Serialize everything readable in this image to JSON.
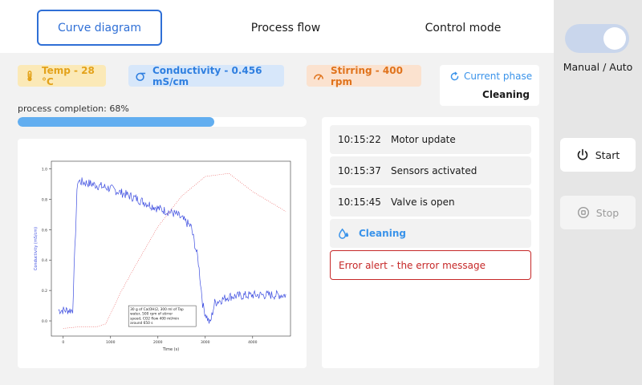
{
  "tabs": [
    {
      "label": "Curve diagram",
      "active": true
    },
    {
      "label": "Process flow",
      "active": false
    },
    {
      "label": "Control mode",
      "active": false
    }
  ],
  "status": {
    "temperature": {
      "label": "Temp - 28 °C",
      "icon": "thermometer-icon",
      "color": "#e3a21a"
    },
    "conductivity": {
      "label": "Conductivity - 0.456 mS/cm",
      "icon": "sigma-icon",
      "color": "#2f7fe0"
    },
    "stirring": {
      "label": "Stirring - 400 rpm",
      "icon": "gauge-icon",
      "color": "#e0731c"
    }
  },
  "phase": {
    "title": "Current phase",
    "value": "Cleaning",
    "icon": "refresh-icon"
  },
  "progress": {
    "label": "process completion: 68%",
    "value": 0.68
  },
  "chart_data": {
    "type": "line",
    "title": "",
    "xlabel": "Time (s)",
    "ylabel": "Conductivity (mS/cm)",
    "xlim": [
      -250,
      4800
    ],
    "ylim": [
      -0.1,
      1.05
    ],
    "x_ticks": [
      "0",
      "1000",
      "2000",
      "3000",
      "4000"
    ],
    "y_ticks": [
      "0.0",
      "0.2",
      "0.4",
      "0.6",
      "0.8",
      "1.0"
    ],
    "grid": false,
    "annotation": [
      "30 g of Ca(OH)2, 300 ml of Tap",
      "water, 500 rpm of stirrer",
      "speed, CO2 flow 400 ml/min",
      "around 650 s"
    ],
    "series": [
      {
        "name": "",
        "color": "#3f4fe0",
        "style": "noisy line",
        "x": [
          -100,
          200,
          250,
          300,
          600,
          1000,
          1500,
          2000,
          2400,
          2700,
          2850,
          2950,
          3000,
          3100,
          3200,
          3500,
          4000,
          4700
        ],
        "y": [
          0.07,
          0.07,
          0.5,
          0.92,
          0.9,
          0.87,
          0.81,
          0.74,
          0.7,
          0.62,
          0.4,
          0.1,
          0.05,
          -0.02,
          0.12,
          0.16,
          0.17,
          0.17
        ]
      },
      {
        "name": "",
        "color": "#e85a5a",
        "style": "dotted",
        "x": [
          0,
          300,
          700,
          900,
          1200,
          1500,
          2000,
          2500,
          3000,
          3500,
          4000,
          4700
        ],
        "y": [
          -0.05,
          -0.04,
          -0.04,
          -0.02,
          0.18,
          0.35,
          0.62,
          0.82,
          0.95,
          0.97,
          0.85,
          0.72
        ]
      }
    ]
  },
  "log": [
    {
      "time": "10:15:22",
      "text": "Motor update"
    },
    {
      "time": "10:15:37",
      "text": "Sensors activated"
    },
    {
      "time": "10:15:45",
      "text": "Valve is open"
    }
  ],
  "log_phase": {
    "text": "Cleaning",
    "icon": "water-drops-icon"
  },
  "log_error": "Error alert - the error message",
  "control": {
    "mode_label": "Manual / Auto",
    "start_label": "Start",
    "stop_label": "Stop"
  }
}
